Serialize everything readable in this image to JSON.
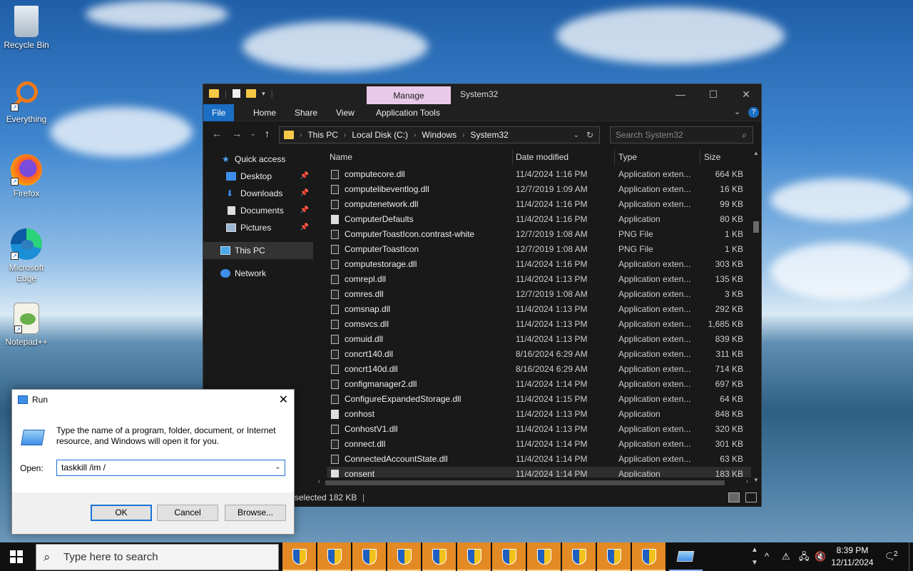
{
  "desktop": {
    "icons": [
      {
        "label": "Recycle Bin",
        "icon": "recycle-bin-icon"
      },
      {
        "label": "Everything",
        "icon": "everything-search-icon"
      },
      {
        "label": "Firefox",
        "icon": "firefox-icon"
      },
      {
        "label": "Microsoft Edge",
        "icon": "edge-icon"
      },
      {
        "label": "Notepad++",
        "icon": "notepad-plus-plus-icon"
      }
    ]
  },
  "explorer": {
    "title": "System32",
    "manage_tab": "Manage",
    "ribbon_tabs": [
      "File",
      "Home",
      "Share",
      "View",
      "Application Tools"
    ],
    "breadcrumb": [
      "This PC",
      "Local Disk (C:)",
      "Windows",
      "System32"
    ],
    "search_placeholder": "Search System32",
    "nav": {
      "quick_access": "Quick access",
      "items": [
        "Desktop",
        "Downloads",
        "Documents",
        "Pictures"
      ],
      "this_pc": "This PC",
      "network": "Network"
    },
    "columns": {
      "name": "Name",
      "date": "Date modified",
      "type": "Type",
      "size": "Size"
    },
    "files": [
      {
        "name": "computecore.dll",
        "date": "11/4/2024 1:16 PM",
        "type": "Application exten...",
        "size": "664 KB"
      },
      {
        "name": "computelibeventlog.dll",
        "date": "12/7/2019 1:09 AM",
        "type": "Application exten...",
        "size": "16 KB"
      },
      {
        "name": "computenetwork.dll",
        "date": "11/4/2024 1:16 PM",
        "type": "Application exten...",
        "size": "99 KB"
      },
      {
        "name": "ComputerDefaults",
        "date": "11/4/2024 1:16 PM",
        "type": "Application",
        "size": "80 KB"
      },
      {
        "name": "ComputerToastIcon.contrast-white",
        "date": "12/7/2019 1:08 AM",
        "type": "PNG File",
        "size": "1 KB"
      },
      {
        "name": "ComputerToastIcon",
        "date": "12/7/2019 1:08 AM",
        "type": "PNG File",
        "size": "1 KB"
      },
      {
        "name": "computestorage.dll",
        "date": "11/4/2024 1:16 PM",
        "type": "Application exten...",
        "size": "303 KB"
      },
      {
        "name": "comrepl.dll",
        "date": "11/4/2024 1:13 PM",
        "type": "Application exten...",
        "size": "135 KB"
      },
      {
        "name": "comres.dll",
        "date": "12/7/2019 1:08 AM",
        "type": "Application exten...",
        "size": "3 KB"
      },
      {
        "name": "comsnap.dll",
        "date": "11/4/2024 1:13 PM",
        "type": "Application exten...",
        "size": "292 KB"
      },
      {
        "name": "comsvcs.dll",
        "date": "11/4/2024 1:13 PM",
        "type": "Application exten...",
        "size": "1,685 KB"
      },
      {
        "name": "comuid.dll",
        "date": "11/4/2024 1:13 PM",
        "type": "Application exten...",
        "size": "839 KB"
      },
      {
        "name": "concrt140.dll",
        "date": "8/16/2024 6:29 AM",
        "type": "Application exten...",
        "size": "311 KB"
      },
      {
        "name": "concrt140d.dll",
        "date": "8/16/2024 6:29 AM",
        "type": "Application exten...",
        "size": "714 KB"
      },
      {
        "name": "configmanager2.dll",
        "date": "11/4/2024 1:14 PM",
        "type": "Application exten...",
        "size": "697 KB"
      },
      {
        "name": "ConfigureExpandedStorage.dll",
        "date": "11/4/2024 1:15 PM",
        "type": "Application exten...",
        "size": "64 KB"
      },
      {
        "name": "conhost",
        "date": "11/4/2024 1:13 PM",
        "type": "Application",
        "size": "848 KB"
      },
      {
        "name": "ConhostV1.dll",
        "date": "11/4/2024 1:13 PM",
        "type": "Application exten...",
        "size": "320 KB"
      },
      {
        "name": "connect.dll",
        "date": "11/4/2024 1:14 PM",
        "type": "Application exten...",
        "size": "301 KB"
      },
      {
        "name": "ConnectedAccountState.dll",
        "date": "11/4/2024 1:14 PM",
        "type": "Application exten...",
        "size": "63 KB"
      },
      {
        "name": "consent",
        "date": "11/4/2024 1:14 PM",
        "type": "Application",
        "size": "183 KB"
      }
    ],
    "status": "selected  182 KB"
  },
  "run": {
    "title": "Run",
    "description": "Type the name of a program, folder, document, or Internet resource, and Windows will open it for you.",
    "open_label": "Open:",
    "input_value": "taskkill /im /",
    "ok": "OK",
    "cancel": "Cancel",
    "browse": "Browse..."
  },
  "taskbar": {
    "search_placeholder": "Type here to search",
    "app_count": 11,
    "time": "8:39 PM",
    "date": "12/11/2024",
    "notification_count": "2"
  }
}
